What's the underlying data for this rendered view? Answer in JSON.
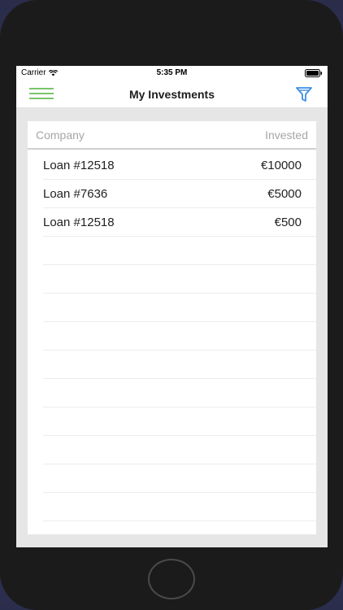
{
  "status_bar": {
    "carrier": "Carrier",
    "time": "5:35 PM"
  },
  "nav": {
    "title": "My Investments",
    "menu_icon": "hamburger-menu-icon",
    "filter_icon": "filter-funnel-icon"
  },
  "table": {
    "headers": {
      "company": "Company",
      "invested": "Invested"
    },
    "rows": [
      {
        "company": "Loan #12518",
        "invested": "€10000"
      },
      {
        "company": "Loan #7636",
        "invested": "€5000"
      },
      {
        "company": "Loan #12518",
        "invested": "€500"
      }
    ]
  },
  "colors": {
    "accent_green": "#7cc46b",
    "accent_blue": "#3a8ee6",
    "background_gray": "#e6e6e6"
  }
}
